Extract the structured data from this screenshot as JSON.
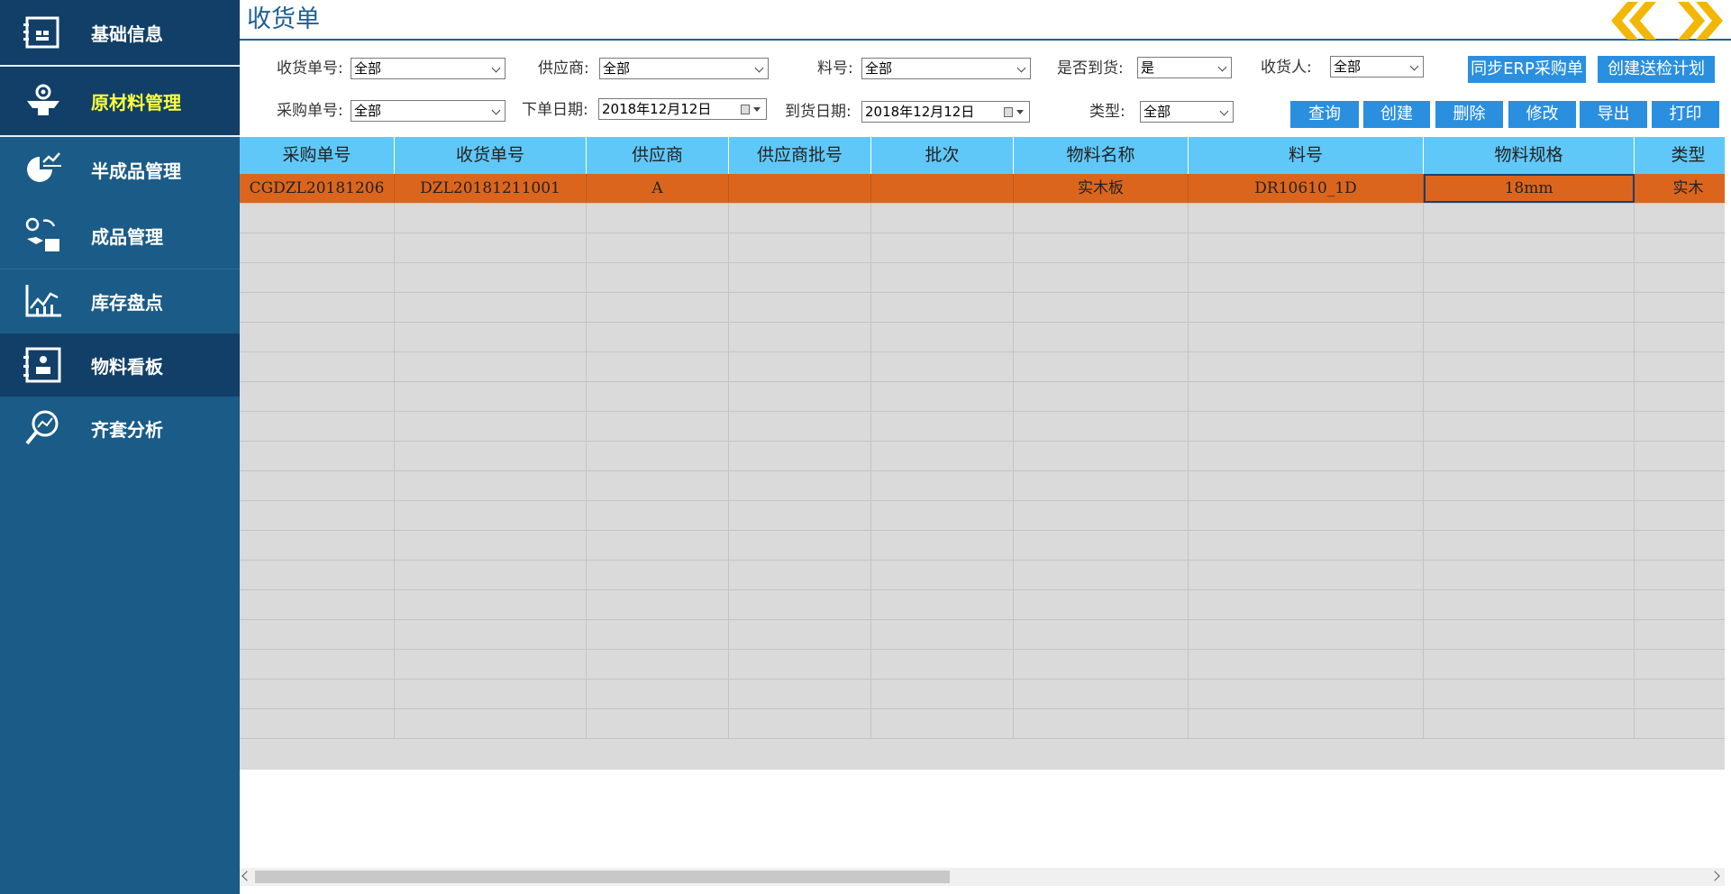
{
  "sidebar": {
    "items": [
      {
        "label": "基础信息",
        "icon": "clipboard-icon"
      },
      {
        "label": "原材料管理",
        "icon": "box-gear-icon"
      },
      {
        "label": "半成品管理",
        "icon": "chart-pie-icon"
      },
      {
        "label": "成品管理",
        "icon": "hand-box-icon"
      },
      {
        "label": "库存盘点",
        "icon": "line-chart-icon"
      },
      {
        "label": "物料看板",
        "icon": "board-icon"
      },
      {
        "label": "齐套分析",
        "icon": "magnifier-chart-icon"
      }
    ],
    "active": "原材料管理"
  },
  "header": {
    "title": "收货单"
  },
  "filters": {
    "receipt_no_label": "收货单号:",
    "receipt_no_value": "全部",
    "supplier_label": "供应商:",
    "supplier_value": "全部",
    "part_no_label": "料号:",
    "part_no_value": "全部",
    "arrived_label": "是否到货:",
    "arrived_value": "是",
    "receiver_label": "收货人:",
    "receiver_value": "全部",
    "po_no_label": "采购单号:",
    "po_no_value": "全部",
    "order_date_label": "下单日期:",
    "order_date_value": "2018年12月12日",
    "arrival_date_label": "到货日期:",
    "arrival_date_value": "2018年12月12日",
    "type_label": "类型:",
    "type_value": "全部"
  },
  "buttons": {
    "sync_erp": "同步ERP采购单",
    "create_inspection": "创建送检计划",
    "query": "查询",
    "create": "创建",
    "delete": "删除",
    "modify": "修改",
    "export": "导出",
    "print": "打印"
  },
  "table": {
    "columns": [
      "采购单号",
      "收货单号",
      "供应商",
      "供应商批号",
      "批次",
      "物料名称",
      "料号",
      "物料规格",
      "类型"
    ],
    "rows": [
      [
        "CGDZL20181206",
        "DZL20181211001",
        "A",
        "",
        "",
        "实木板",
        "DR10610_1D",
        "18mm",
        "实木"
      ]
    ],
    "selected_row": 0,
    "focused_column": 7
  },
  "colors": {
    "sidebar_bg": "#1a5b87",
    "sidebar_dark": "#113f68",
    "active_label": "#ffff3c",
    "header_blue": "#60c8f8",
    "button_blue": "#2b8fe0",
    "selected_row": "#dc651d",
    "arrow_gold": "#f2b705"
  }
}
